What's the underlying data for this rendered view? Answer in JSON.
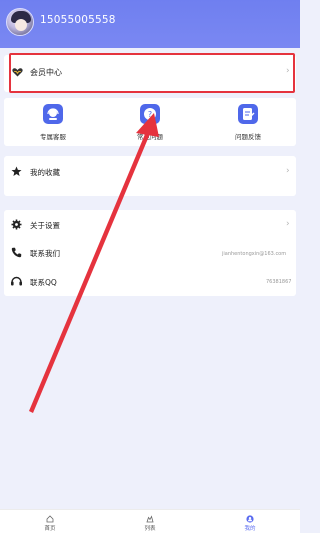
{
  "header": {
    "phone": "15055005558"
  },
  "vip": {
    "label": "会员中心",
    "chevron": "›"
  },
  "quick_actions": [
    {
      "label": "专属客服",
      "icon": "customer-service-icon"
    },
    {
      "label": "常见问题",
      "icon": "question-icon"
    },
    {
      "label": "问题反馈",
      "icon": "feedback-icon"
    }
  ],
  "favorites": {
    "label": "我的收藏",
    "chevron": "›"
  },
  "settings": {
    "about": {
      "label": "关于设置",
      "chevron": "›"
    },
    "contact": {
      "label": "联系我们",
      "value": "jianhentongxin@163.com"
    },
    "qq": {
      "label": "联系QQ",
      "value": "76381867"
    }
  },
  "tabbar": [
    {
      "label": "首页",
      "icon": "home-icon",
      "active": false
    },
    {
      "label": "列表",
      "icon": "list-icon",
      "active": false
    },
    {
      "label": "我的",
      "icon": "profile-icon",
      "active": true
    }
  ],
  "colors": {
    "header": "#7380f1",
    "accent": "#4f68ea",
    "highlight": "#e5333e",
    "background": "#eef0fb"
  }
}
